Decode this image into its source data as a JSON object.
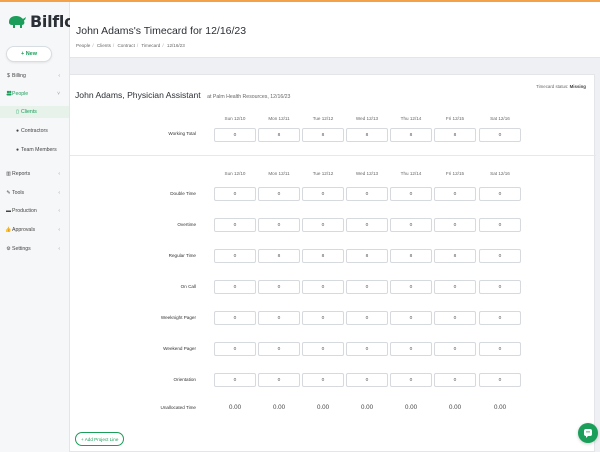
{
  "app": {
    "name": "Bilflo",
    "new_label": "+ New"
  },
  "sidebar": {
    "items": [
      {
        "label": "Billing",
        "icon": "dollar-icon"
      },
      {
        "label": "People",
        "icon": "people-icon"
      },
      {
        "label": "Clients",
        "icon": "clients-icon"
      },
      {
        "label": "Contractors",
        "icon": "person-icon"
      },
      {
        "label": "Team Members",
        "icon": "person-icon"
      },
      {
        "label": "Reports",
        "icon": "chart-icon"
      },
      {
        "label": "Tools",
        "icon": "wrench-icon"
      },
      {
        "label": "Production",
        "icon": "print-icon"
      },
      {
        "label": "Approvals",
        "icon": "thumbs-up-icon"
      },
      {
        "label": "Settings",
        "icon": "gear-icon"
      }
    ]
  },
  "header": {
    "title": "John Adams's Timecard for 12/16/23",
    "breadcrumb": [
      "People",
      "Clients",
      "Contract",
      "Timecard",
      "12/16/23"
    ]
  },
  "card": {
    "worker": "John Adams, Physician Assistant",
    "company": "at Palm Health Resources, 12/16/23",
    "status_label": "Timecard status:",
    "status_value": "Missing"
  },
  "days": [
    "Sun 12/10",
    "Mon 12/11",
    "Tue 12/12",
    "Wed 12/13",
    "Thu 12/14",
    "Fri 12/15",
    "Sat 12/16"
  ],
  "working_total": {
    "label": "Working Total",
    "values": [
      "0",
      "8",
      "8",
      "8",
      "8",
      "8",
      "0"
    ]
  },
  "rows": [
    {
      "label": "Double Time",
      "values": [
        "0",
        "0",
        "0",
        "0",
        "0",
        "0",
        "0"
      ]
    },
    {
      "label": "Overtime",
      "values": [
        "0",
        "0",
        "0",
        "0",
        "0",
        "0",
        "0"
      ]
    },
    {
      "label": "Regular Time",
      "values": [
        "0",
        "8",
        "8",
        "8",
        "8",
        "8",
        "0"
      ]
    },
    {
      "label": "On Call",
      "values": [
        "0",
        "0",
        "0",
        "0",
        "0",
        "0",
        "0"
      ]
    },
    {
      "label": "Weeknight Pager",
      "values": [
        "0",
        "0",
        "0",
        "0",
        "0",
        "0",
        "0"
      ]
    },
    {
      "label": "Weekend Pager",
      "values": [
        "0",
        "0",
        "0",
        "0",
        "0",
        "0",
        "0"
      ]
    },
    {
      "label": "Orientation",
      "values": [
        "0",
        "0",
        "0",
        "0",
        "0",
        "0",
        "0"
      ]
    }
  ],
  "unallocated": {
    "label": "Unallocated Time",
    "values": [
      "0.00",
      "0.00",
      "0.00",
      "0.00",
      "0.00",
      "0.00",
      "0.00"
    ]
  },
  "add_project_line": "+ Add Project Line",
  "colors": {
    "brand": "#1b9e5a",
    "accent_top": "#f3a24a"
  }
}
